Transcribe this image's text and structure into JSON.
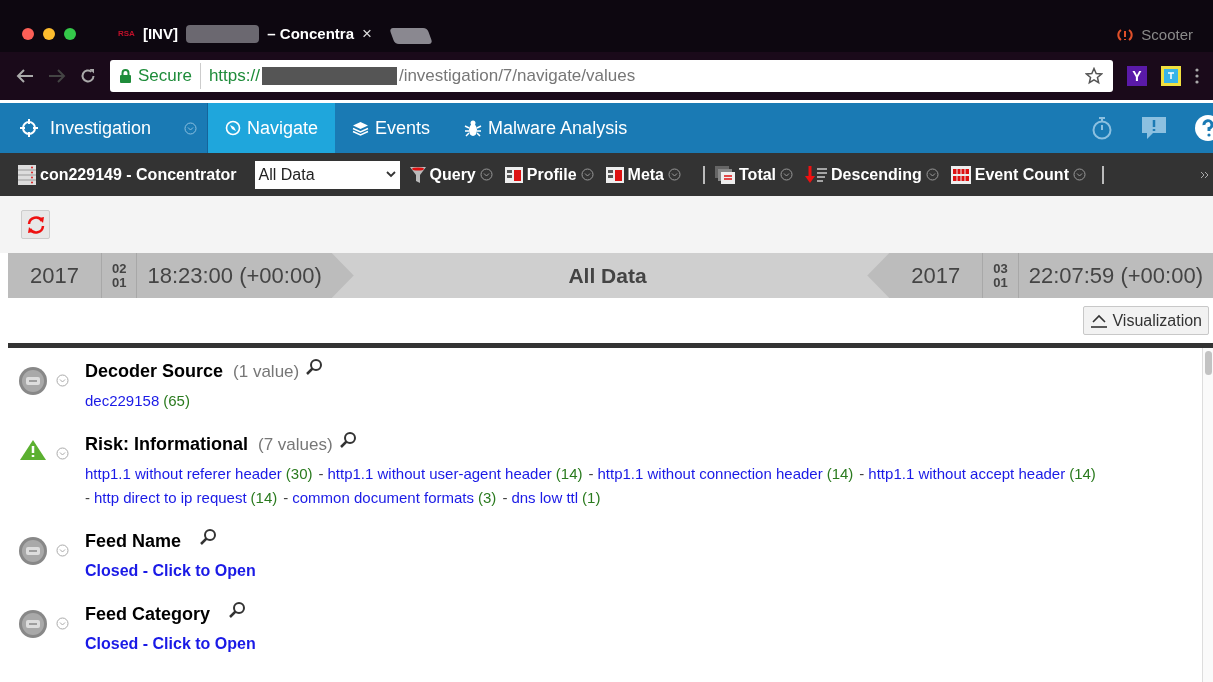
{
  "browser": {
    "tab_logo": "RSA",
    "tab_title_prefix": "[INV]",
    "tab_title_suffix": "– Concentra",
    "tab_close": "×",
    "secure_label": "Secure",
    "url_scheme": "https://",
    "url_path": "/investigation/7/navigate/values",
    "extension_letter": "Y",
    "profile": "Scooter"
  },
  "app_nav": {
    "title": "Investigation",
    "tabs": [
      {
        "label": "Navigate",
        "selected": true
      },
      {
        "label": "Events",
        "selected": false
      },
      {
        "label": "Malware Analysis",
        "selected": false
      }
    ]
  },
  "toolbar": {
    "service": "con229149 - Concentrator",
    "data_select": "All Data",
    "items": [
      {
        "label": "Query",
        "kind": "query"
      },
      {
        "label": "Profile",
        "kind": "profile"
      },
      {
        "label": "Meta",
        "kind": "meta"
      },
      {
        "label": "Total",
        "kind": "total"
      },
      {
        "label": "Descending",
        "kind": "descending"
      },
      {
        "label": "Event Count",
        "kind": "count"
      }
    ]
  },
  "time_range": {
    "start": {
      "year": "2017",
      "month": "02",
      "day": "01",
      "time": "18:23:00 (+00:00)"
    },
    "title": "All Data",
    "end": {
      "year": "2017",
      "month": "03",
      "day": "01",
      "time": "22:07:59 (+00:00)"
    }
  },
  "visualization_button": "Visualization",
  "meta_groups": [
    {
      "kind": "normal",
      "title": "Decoder Source",
      "count_text": "(1 value)",
      "values": [
        {
          "label": "dec229158",
          "count": "(65)"
        }
      ]
    },
    {
      "kind": "risk",
      "title": "Risk: Informational",
      "count_text": "(7 values)",
      "values": [
        {
          "label": "http1.1 without referer header",
          "count": "(30)"
        },
        {
          "separator": "-",
          "label": "http1.1 without user-agent header",
          "count": "(14)"
        },
        {
          "separator": "-",
          "label": "http1.1 without connection header",
          "count": "(14)"
        },
        {
          "separator": "-",
          "label": "http1.1 without accept header",
          "count": "(14)"
        },
        {
          "separator": "-",
          "label": "http direct to ip request",
          "count": "(14)"
        },
        {
          "separator": "-",
          "label": "common document formats",
          "count": "(3)"
        },
        {
          "separator": "-",
          "label": "dns low ttl",
          "count": "(1)"
        }
      ]
    },
    {
      "kind": "normal",
      "title": "Feed Name",
      "closed_label": "Closed - Click to Open"
    },
    {
      "kind": "normal",
      "title": "Feed Category",
      "closed_label": "Closed - Click to Open"
    }
  ]
}
